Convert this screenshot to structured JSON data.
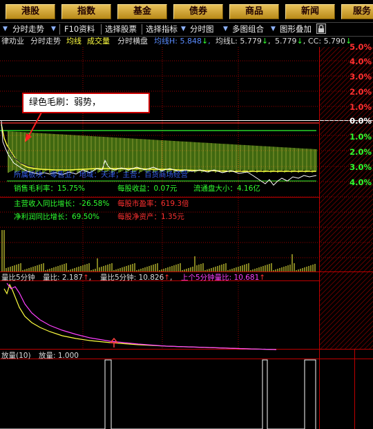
{
  "topnav": {
    "buttons": [
      "港股",
      "指数",
      "基金",
      "债券",
      "商品",
      "新闻",
      "服务"
    ]
  },
  "toolbar": {
    "items": [
      "分时走势",
      "F10资料",
      "选择股票",
      "选择指标",
      "分时图",
      "多图组合",
      "图形叠加"
    ]
  },
  "header": {
    "stock_partial": "律劝业",
    "tab_timechart": "分时走势",
    "avg_line": "均线",
    "volume": "成交量",
    "time_horizontal": "分时横盘",
    "ma_h_label": "均线H: 5.848",
    "ma_l_label": "均线L: 5.779",
    "val3": "5.779",
    "cc_label": "CC: 5.790"
  },
  "right_axis": {
    "up": [
      "5.0%",
      "4.0%",
      "3.0%",
      "2.0%",
      "1.0%"
    ],
    "zero": "0.0%",
    "down": [
      "1.0%",
      "2.0%",
      "3.0%",
      "4.0%"
    ]
  },
  "colors": {
    "up": "#ff3030",
    "down": "#30ff30",
    "zero": "#ffffff",
    "grid_red": "#c00000",
    "nav_gold": "#d4a531"
  },
  "callout": {
    "text": "绿色毛刷：弱势，"
  },
  "overlay_text": {
    "f10_line": "所属板块：零售业；地域：天津；主营：百货商场经营",
    "gross_margin": "销售毛利率：15.75%",
    "eps": "每股收益：0.07元",
    "float_cap": "流通盘大小：4.16亿",
    "rev_growth": "主营收入同比增长：-26.58%",
    "pe": "每股市盈率：619.3倍",
    "profit_growth": "净利润同比增长：69.50%",
    "bvps": "每股净资产：1.35元"
  },
  "ratio_panel": {
    "title": "量比5分钟",
    "lb_label": "量比: 2.187",
    "lb5_label": "量比5分钟: 10.826",
    "prev5_label": "上个5分钟量比: 10.681"
  },
  "vol_panel": {
    "title": "放量(10)",
    "value_label": "放量: 1.000"
  }
}
